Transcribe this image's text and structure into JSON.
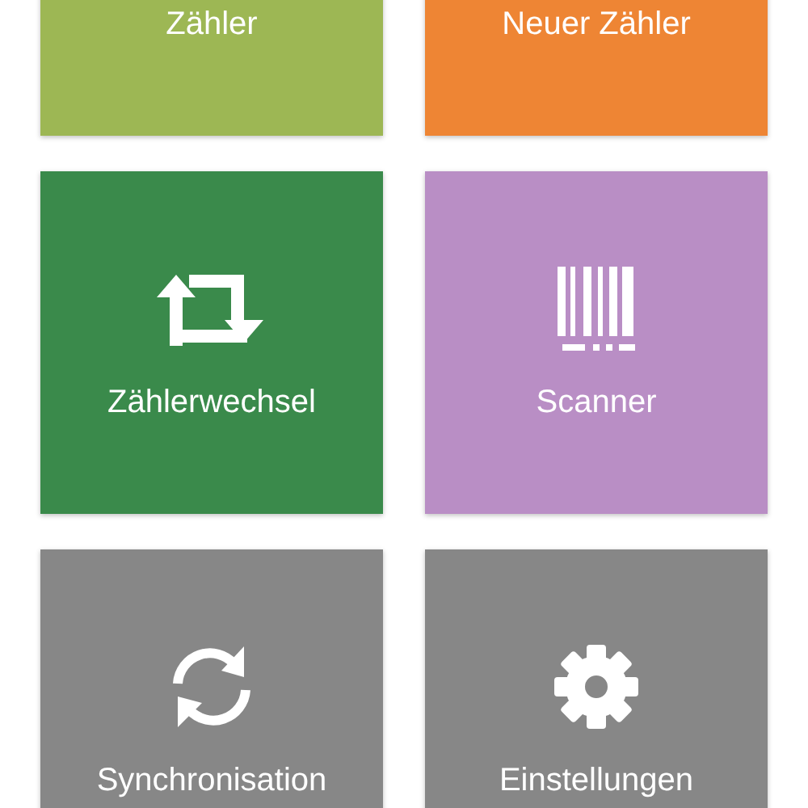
{
  "tiles": [
    {
      "label": "Zähler",
      "color": "#9db754"
    },
    {
      "label": "Neuer Zähler",
      "color": "#ee8534"
    },
    {
      "label": "Zählerwechsel",
      "color": "#3a8a4b",
      "kind": "repeat"
    },
    {
      "label": "Scanner",
      "color": "#b98ec5",
      "kind": "barcode"
    },
    {
      "label": "Synchronisation",
      "color": "#878787",
      "kind": "sync"
    },
    {
      "label": "Einstellungen",
      "color": "#878787",
      "kind": "gear"
    }
  ]
}
